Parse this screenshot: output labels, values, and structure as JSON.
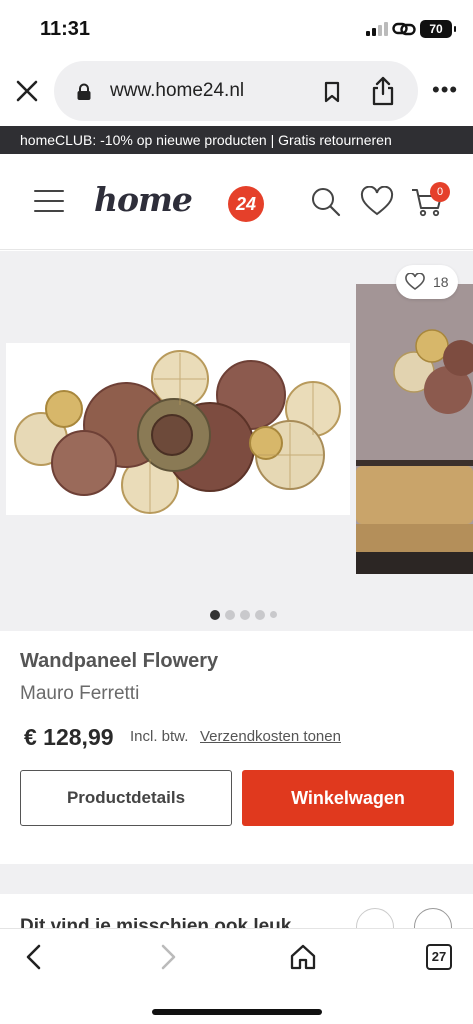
{
  "status_bar": {
    "time": "11:31",
    "battery": "70"
  },
  "browser": {
    "url": "www.home24.nl",
    "tab_count": "27"
  },
  "promo": {
    "text": "homeCLUB: -10% op nieuwe producten | Gratis retourneren"
  },
  "header": {
    "logo_text": "home",
    "logo_badge": "24",
    "cart_count": "0"
  },
  "gallery": {
    "favorite_count": "18",
    "dots_total": 5,
    "dots_active": 1
  },
  "product": {
    "title": "Wandpaneel Flowery",
    "brand": "Mauro Ferretti",
    "price": "€ 128,99",
    "price_note": "Incl. btw.",
    "shipping_link": "Verzendkosten tonen",
    "details_button": "Productdetails",
    "cart_button": "Winkelwagen"
  },
  "recommendations": {
    "title": "Dit vind je misschien ook leuk"
  },
  "colors": {
    "accent": "#e0391e",
    "promo_bg": "#2f2f33",
    "gallery_bg": "#f0f0f2"
  }
}
